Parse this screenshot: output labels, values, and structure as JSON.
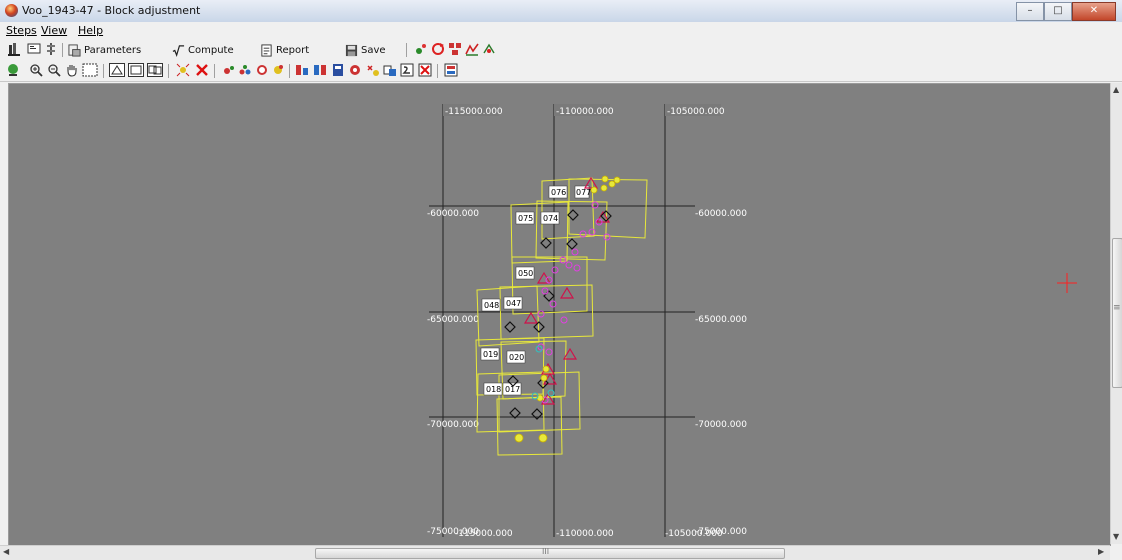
{
  "window": {
    "title": "Voo_1943-47 - Block adjustment",
    "buttons": {
      "minimize": "–",
      "maximize": "□",
      "close": "✕"
    }
  },
  "menu": [
    "Steps",
    "View",
    "Help"
  ],
  "toolbar1": {
    "parameters_label": "Parameters",
    "compute_label": "Compute",
    "report_label": "Report",
    "save_label": "Save"
  },
  "canvas": {
    "background": "#808080",
    "grid_labels": {
      "x_top": [
        "-115000.000",
        "-110000.000",
        "-105000.000"
      ],
      "y_left": [
        "-60000.000",
        "-65000.000",
        "-70000.000",
        "-75000.000"
      ],
      "y_right": [
        "-60000.000",
        "-65000.000",
        "-70000.000",
        "-75000.000"
      ],
      "x_bottom": [
        "-115000.000",
        "-110000.000",
        "-105000.000"
      ]
    },
    "photo_labels": [
      "076",
      "077",
      "075",
      "074",
      "050",
      "048",
      "047",
      "019",
      "020",
      "018",
      "017"
    ],
    "colors": {
      "footprint": "#e8e83a",
      "triangle": "#d0114a",
      "diamond": "#111111",
      "tie": "#e040e0",
      "cursor": "#ff2020"
    }
  },
  "scroll": {
    "h_mid": "III",
    "v_mid": "≡"
  }
}
